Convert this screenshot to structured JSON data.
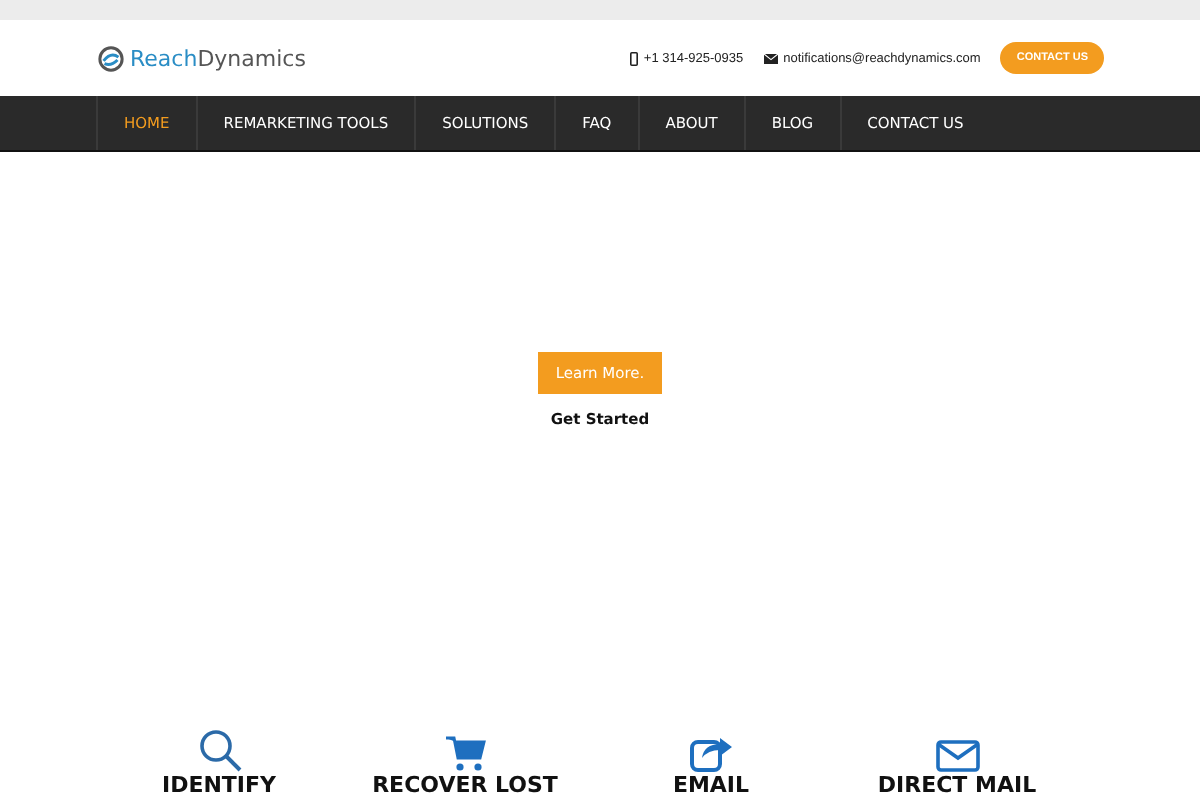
{
  "header": {
    "logo": {
      "part_1": "Reach",
      "part_2": "Dynamics"
    },
    "phone": "+1 314-925-0935",
    "email": "notifications@reachdynamics.com",
    "contact_button": "CONTACT US"
  },
  "nav": [
    {
      "label": "HOME",
      "selected": true
    },
    {
      "label": "REMARKETING TOOLS",
      "selected": false
    },
    {
      "label": "SOLUTIONS",
      "selected": false
    },
    {
      "label": "FAQ",
      "selected": false
    },
    {
      "label": "ABOUT",
      "selected": false
    },
    {
      "label": "BLOG",
      "selected": false
    },
    {
      "label": "CONTACT US",
      "selected": false
    }
  ],
  "hero": {
    "button": "Learn More.",
    "link": "Get Started"
  },
  "features": [
    {
      "kind": "search",
      "label": "IDENTIFY"
    },
    {
      "kind": "cart",
      "label": "RECOVER LOST"
    },
    {
      "kind": "share",
      "label": "EMAIL"
    },
    {
      "kind": "mail",
      "label": "DIRECT MAIL"
    }
  ]
}
